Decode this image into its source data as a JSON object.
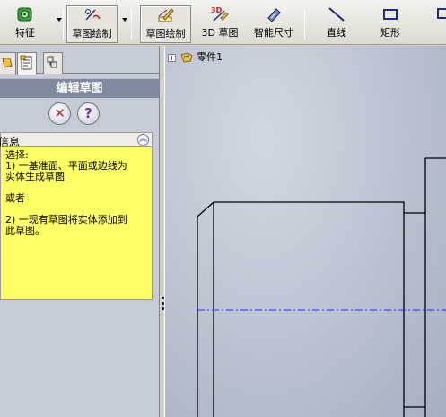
{
  "toolbar": {
    "items": [
      {
        "label": "特征",
        "icon": "features-icon"
      },
      {
        "label": "草图绘制",
        "icon": "sketch-dropdown-icon"
      },
      {
        "label": "草图绘制",
        "icon": "sketch-icon"
      },
      {
        "label": "3D 草图",
        "icon": "3d-sketch-icon"
      },
      {
        "label": "智能尺寸",
        "icon": "smart-dimension-icon"
      },
      {
        "label": "直线",
        "icon": "line-icon"
      },
      {
        "label": "矩形",
        "icon": "rectangle-icon"
      }
    ],
    "icon_badge_3d": "3D"
  },
  "left_panel": {
    "title": "编辑草图",
    "cancel_glyph": "✕",
    "help_glyph": "?",
    "message_header": "信息",
    "message_lines": [
      "选择:",
      "1) 一基准面、平面或边线为",
      "实体生成草图",
      "",
      "或者",
      "",
      "2) 一现有草图将实体添加到",
      "此草图。"
    ]
  },
  "canvas": {
    "tree_item": "零件1",
    "expand_glyph": "+"
  },
  "colors": {
    "panel_title_bg": "#7f8aa0",
    "message_bg": "#ffff66",
    "centerline": "#2a2aff"
  }
}
